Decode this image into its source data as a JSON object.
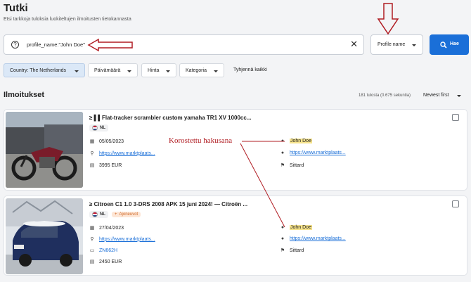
{
  "page": {
    "title": "Tutki",
    "subtitle": "Etsi tarkkoja tuloksia luokiteltujen ilmoitusten tietokannasta"
  },
  "search": {
    "query": "profile_name:\"John Doe\"",
    "field": "Profile name",
    "button": "Hae"
  },
  "filters": {
    "country": "Country: The Netherlands",
    "date": "Päivämäärä",
    "price": "Hinta",
    "category": "Kategoria",
    "clear_all": "Tyhjennä kaikki"
  },
  "results": {
    "heading": "Ilmoitukset",
    "count": "181 tulosta (0.675 sekuntia)",
    "sort": "Newest first"
  },
  "annotation": {
    "label": "Korostettu hakusana"
  },
  "colors": {
    "primary": "#1a6fd8",
    "highlight": "#f6e38c",
    "annotation": "#b01c22"
  },
  "cards": [
    {
      "title": "≥ ▌▌Flat-tracker scrambler custom yamaha TR1 XV 1000cc...",
      "country": "NL",
      "date": "05/05/2023",
      "url": "https://www.marktplaats...",
      "price": "3995 EUR",
      "profile": "John Doe",
      "profile_url": "https://www.marktplaats...",
      "location": "Sittard"
    },
    {
      "title": "≥ Citroen C1 1.0 3-DRS 2008 APK 15 juni 2024! — Citroën ...",
      "country": "NL",
      "category": "Ajoneuvot",
      "date": "27/04/2023",
      "url": "https://www.marktplaats...",
      "plate": "ZN662H",
      "price": "2450 EUR",
      "profile": "John Doe",
      "profile_url": "https://www.marktplaats...",
      "location": "Sittard"
    }
  ]
}
